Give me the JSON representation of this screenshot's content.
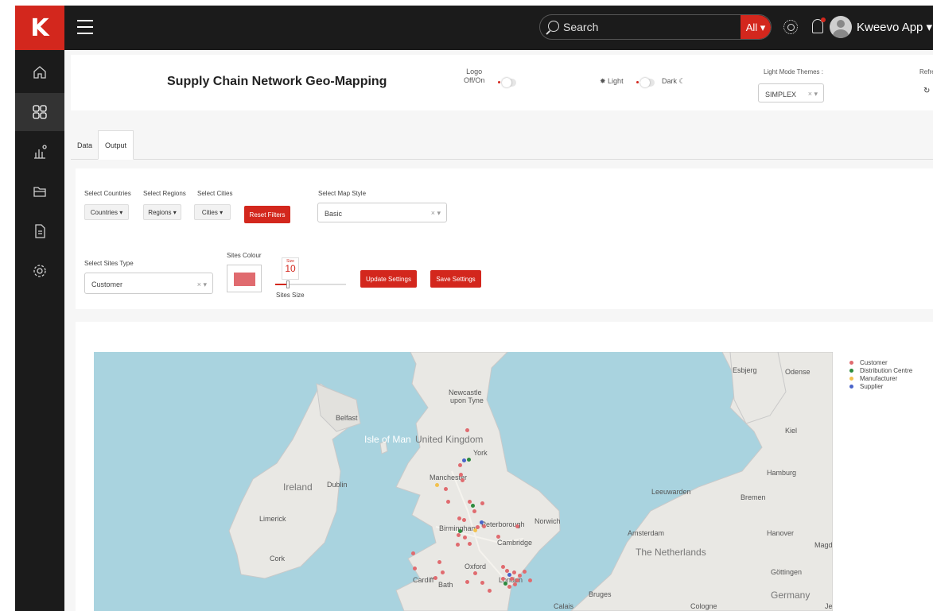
{
  "topbar": {
    "search_placeholder": "Search",
    "search_scope": "All ▾",
    "user_name": "Kweevo App ▾"
  },
  "header": {
    "title": "Supply Chain Network Geo-Mapping",
    "logo_label_1": "Logo",
    "logo_label_2": "Off/On",
    "light_label": "Light",
    "dark_label": "Dark",
    "theme_label": "Light Mode Themes :",
    "theme_value": "SIMPLEX",
    "refresh_label": "Refresh"
  },
  "tabs": [
    "Data",
    "Output"
  ],
  "filters": {
    "countries_label": "Select Countries",
    "countries_btn": "Countries ▾",
    "regions_label": "Select Regions",
    "regions_btn": "Regions ▾",
    "cities_label": "Select Cities",
    "cities_btn": "Cities ▾",
    "reset_btn": "Reset Filters",
    "map_style_label": "Select Map Style",
    "map_style_value": "Basic",
    "sites_type_label": "Select Sites Type",
    "sites_type_value": "Customer",
    "sites_colour_label": "Sites Colour",
    "sites_colour": "#e06b6f",
    "size_caption": "Size",
    "size_value": "10",
    "size_label": "Sites Size",
    "update_btn": "Update Settings",
    "save_btn": "Save Settings"
  },
  "legend": [
    {
      "label": "Customer",
      "color": "#e06b6f"
    },
    {
      "label": "Distribution Centre",
      "color": "#2e8b3e"
    },
    {
      "label": "Manufacturer",
      "color": "#f2c14e"
    },
    {
      "label": "Supplier",
      "color": "#4a64c9"
    }
  ],
  "map_labels": {
    "newcastle": "Newcastle",
    "newcastle2": "upon Tyne",
    "belfast": "Belfast",
    "isle_of_man": "Isle of Man",
    "uk": "United Kingdom",
    "york": "York",
    "manchester": "Manchester",
    "ireland": "Ireland",
    "dublin": "Dublin",
    "limerick": "Limerick",
    "cork": "Cork",
    "birmingham": "Birmingham",
    "peterborough": "Peterborough",
    "norwich": "Norwich",
    "cambridge": "Cambridge",
    "oxford": "Oxford",
    "cardiff": "Cardiff",
    "bath": "Bath",
    "london": "London",
    "calais": "Calais",
    "bruges": "Bruges",
    "esbjerg": "Esbjerg",
    "odense": "Odense",
    "kiel": "Kiel",
    "hamburg": "Hamburg",
    "bremen": "Bremen",
    "leeuwarden": "Leeuwarden",
    "amsterdam": "Amsterdam",
    "netherlands": "The Netherlands",
    "hanover": "Hanover",
    "magd": "Magd",
    "gottingen": "Göttingen",
    "germany": "Germany",
    "cologne": "Cologne",
    "je": "Je"
  },
  "icons": {
    "logo": "K",
    "home": "home-icon",
    "dashboard": "dashboard-icon",
    "analytics": "chart-icon",
    "folder": "folder-icon",
    "document": "document-icon",
    "settings": "gear-icon"
  }
}
